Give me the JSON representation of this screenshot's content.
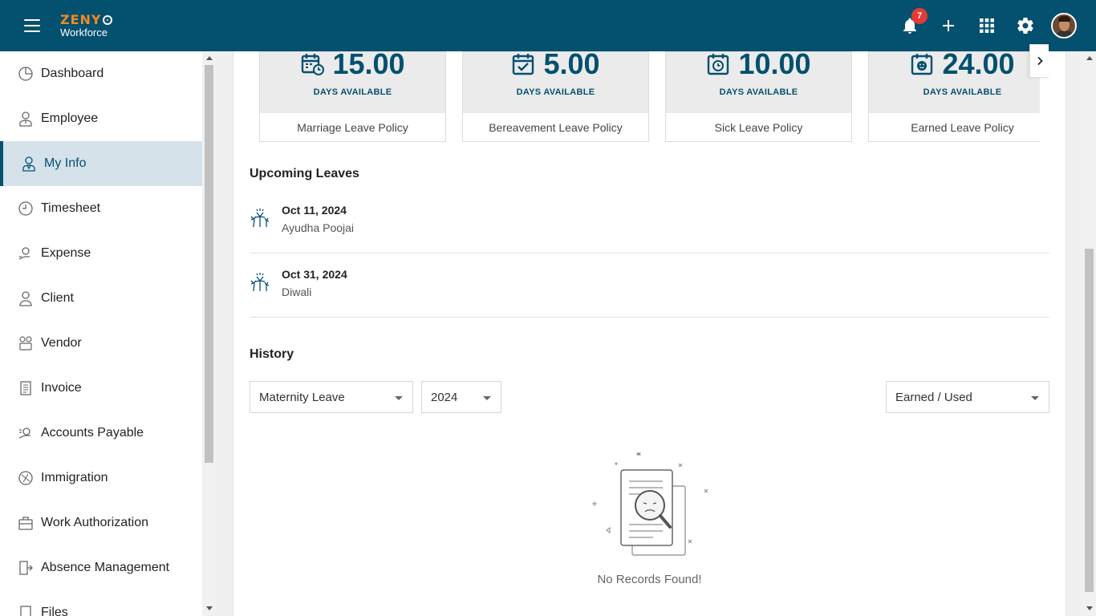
{
  "header": {
    "logo_top": "ZENY",
    "logo_bottom": "Workforce",
    "notification_count": "7"
  },
  "sidebar": {
    "items": [
      {
        "label": "Dashboard",
        "icon": "dashboard-icon"
      },
      {
        "label": "Employee",
        "icon": "employee-icon"
      },
      {
        "label": "My Info",
        "icon": "my-info-icon",
        "active": true
      },
      {
        "label": "Timesheet",
        "icon": "timesheet-icon"
      },
      {
        "label": "Expense",
        "icon": "expense-icon"
      },
      {
        "label": "Client",
        "icon": "client-icon"
      },
      {
        "label": "Vendor",
        "icon": "vendor-icon"
      },
      {
        "label": "Invoice",
        "icon": "invoice-icon"
      },
      {
        "label": "Accounts Payable",
        "icon": "accounts-payable-icon"
      },
      {
        "label": "Immigration",
        "icon": "immigration-icon"
      },
      {
        "label": "Work Authorization",
        "icon": "work-authorization-icon"
      },
      {
        "label": "Absence Management",
        "icon": "absence-management-icon"
      },
      {
        "label": "Files",
        "icon": "files-icon"
      }
    ]
  },
  "leave_cards": [
    {
      "value": "15.00",
      "available_label": "DAYS AVAILABLE",
      "policy": "Marriage Leave Policy",
      "icon": "calendar-clock-icon"
    },
    {
      "value": "5.00",
      "available_label": "DAYS AVAILABLE",
      "policy": "Bereavement Leave Policy",
      "icon": "calendar-check-icon"
    },
    {
      "value": "10.00",
      "available_label": "DAYS AVAILABLE",
      "policy": "Sick Leave Policy",
      "icon": "calendar-clock-icon"
    },
    {
      "value": "24.00",
      "available_label": "DAYS AVAILABLE",
      "policy": "Earned Leave Policy",
      "icon": "calendar-smile-icon"
    }
  ],
  "upcoming": {
    "title": "Upcoming Leaves",
    "items": [
      {
        "date": "Oct 11, 2024",
        "name": "Ayudha Poojai"
      },
      {
        "date": "Oct 31, 2024",
        "name": "Diwali"
      }
    ]
  },
  "history": {
    "title": "History",
    "leave_type": "Maternity Leave",
    "year": "2024",
    "mode": "Earned / Used",
    "empty_text": "No Records Found!"
  },
  "colors": {
    "primary": "#03506f",
    "accent": "#f08a24",
    "badge": "#e53935"
  }
}
